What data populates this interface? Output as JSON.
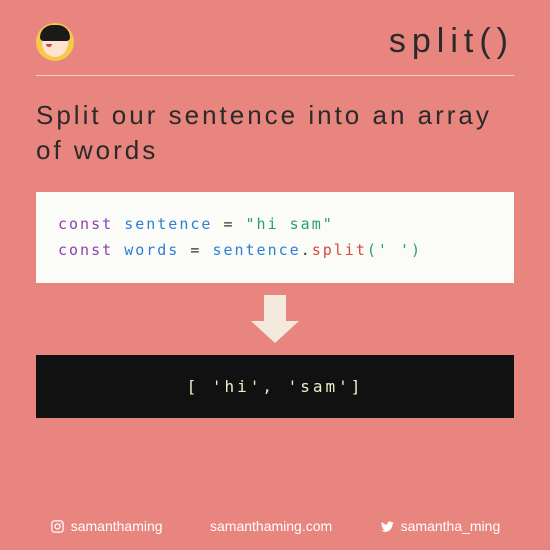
{
  "header": {
    "title": "split()"
  },
  "subtitle": "Split our sentence into an array of words",
  "code": {
    "l1": {
      "kw": "const",
      "var": "sentence",
      "op": "=",
      "str": "\"hi sam\""
    },
    "l2": {
      "kw": "const",
      "var": "words",
      "op": "=",
      "obj": "sentence",
      "dot": ".",
      "fn": "split",
      "args": "(' ')"
    }
  },
  "output": "[ 'hi', 'sam']",
  "footer": {
    "instagram": "samanthaming",
    "website": "samanthaming.com",
    "twitter": "samantha_ming"
  }
}
